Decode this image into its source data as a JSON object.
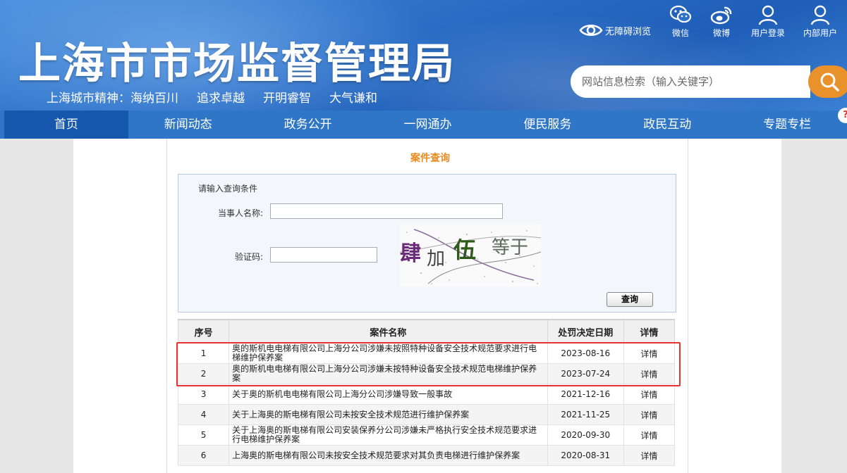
{
  "header": {
    "site_title": "上海市市场监督管理局",
    "slogan": [
      "上海城市精神：海纳百川",
      "追求卓越",
      "开明睿智",
      "大气谦和"
    ],
    "tools": {
      "accessibility": "无障碍浏览",
      "wechat": "微信",
      "weibo": "微博",
      "user_login": "用户登录",
      "internal_user": "内部用户"
    },
    "search_placeholder": "网站信息检索（输入关键字）",
    "search_value": "网站信息检索（输入关键字）"
  },
  "nav": {
    "items": [
      "首页",
      "新闻动态",
      "政务公开",
      "一网通办",
      "便民服务",
      "政民互动",
      "专题专栏"
    ],
    "active_index": 0
  },
  "query": {
    "title": "案件查询",
    "hint": "请输入查询条件",
    "party_label": "当事人名称:",
    "captcha_label": "验证码:",
    "captcha_chars": [
      "肆",
      "加",
      "伍",
      "等于"
    ],
    "submit": "查询"
  },
  "table": {
    "headers": [
      "序号",
      "案件名称",
      "处罚决定日期",
      "详情"
    ],
    "rows": [
      {
        "no": "1",
        "name": "奥的斯机电电梯有限公司上海分公司涉嫌未按照特种设备安全技术规范要求进行电梯维护保养案",
        "date": "2023-08-16",
        "detail": "详情"
      },
      {
        "no": "2",
        "name": "奥的斯机电电梯有限公司上海分公司涉嫌未按特种设备安全技术规范电梯维护保养案",
        "date": "2023-07-24",
        "detail": "详情"
      },
      {
        "no": "3",
        "name": "关于奥的斯机电电梯有限公司上海分公司涉嫌导致一般事故",
        "date": "2021-12-16",
        "detail": "详情"
      },
      {
        "no": "4",
        "name": "关于上海奥的斯电梯有限公司未按安全技术规范进行维护保养案",
        "date": "2021-11-25",
        "detail": "详情"
      },
      {
        "no": "5",
        "name": "关于上海奥的斯电梯有限公司安装保养分公司涉嫌未严格执行安全技术规范要求进行电梯维护保养案",
        "date": "2020-09-30",
        "detail": "详情"
      },
      {
        "no": "6",
        "name": "上海奥的斯电梯有限公司未按安全技术规范要求对其负责电梯进行维护保养案",
        "date": "2020-08-31",
        "detail": "详情"
      }
    ]
  },
  "colors": {
    "header_blue": "#2b6fc7",
    "nav_blue": "#2f77c6",
    "nav_active": "#1558ad",
    "search_button": "#e9912a",
    "query_title": "#e98a1f",
    "highlight": "#e53333"
  },
  "icons": {
    "accessibility": "eye-icon",
    "wechat": "wechat-icon",
    "weibo": "weibo-icon",
    "user_login": "user-icon",
    "internal_user": "user-icon",
    "search": "search-icon"
  }
}
